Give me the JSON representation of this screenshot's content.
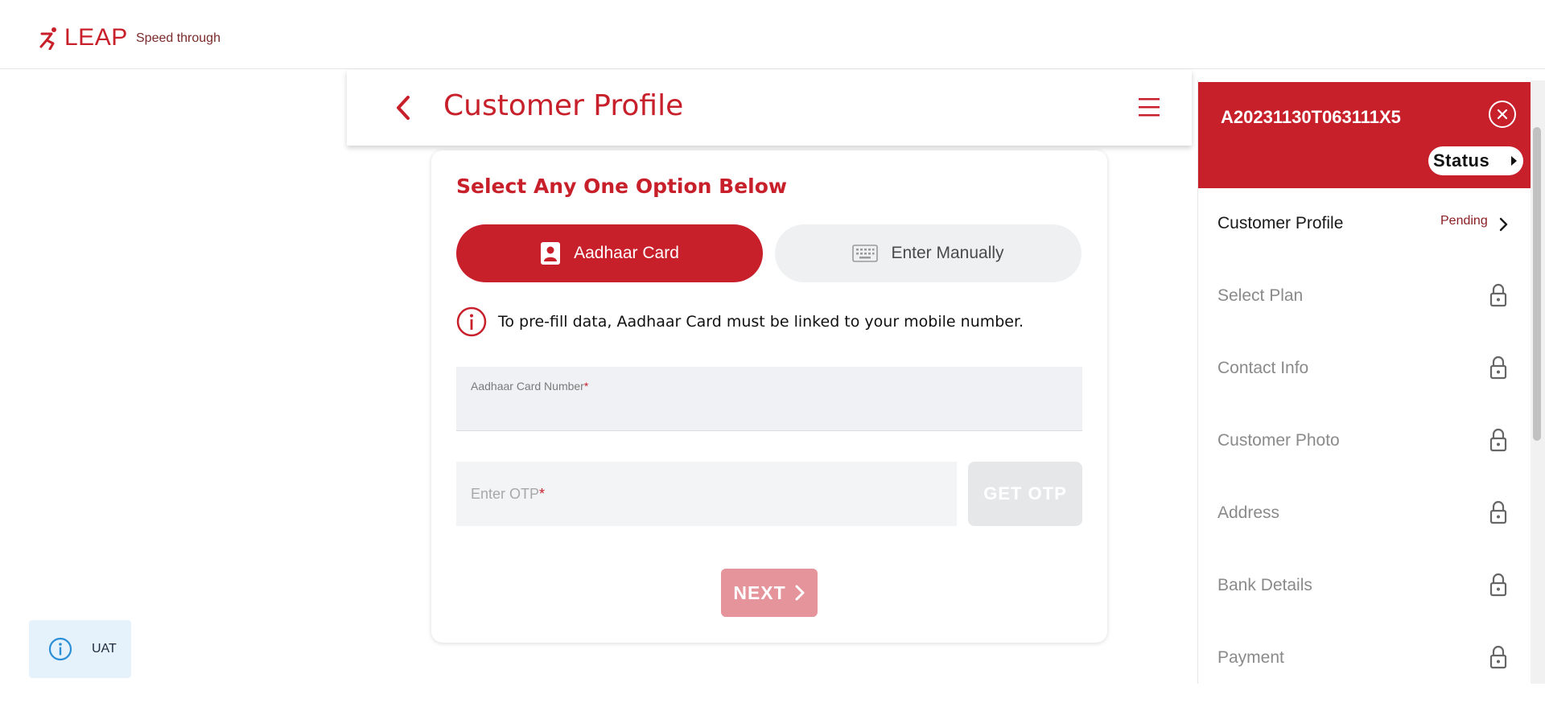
{
  "brand": {
    "logo_text": "LEAP",
    "tagline": "Speed through"
  },
  "header": {
    "title": "Customer Profile"
  },
  "form": {
    "section_title": "Select Any One Option Below",
    "option_aadhaar": "Aadhaar Card",
    "option_manual": "Enter Manually",
    "info_text": "To pre-fill data, Aadhaar Card must be linked to your mobile number.",
    "aadhaar_label": "Aadhaar Card Number",
    "required_mark": "*",
    "otp_placeholder": "Enter OTP",
    "get_otp_label": "GET OTP",
    "next_label": "NEXT"
  },
  "env_badge": {
    "label": "UAT"
  },
  "sidebar": {
    "application_id": "A20231130T063111X5",
    "status_label": "Status",
    "steps": [
      {
        "label": "Customer Profile",
        "status": "Pending",
        "locked": false
      },
      {
        "label": "Select Plan",
        "locked": true
      },
      {
        "label": "Contact Info",
        "locked": true
      },
      {
        "label": "Customer Photo",
        "locked": true
      },
      {
        "label": "Address",
        "locked": true
      },
      {
        "label": "Bank Details",
        "locked": true
      },
      {
        "label": "Payment",
        "locked": true
      }
    ]
  },
  "colors": {
    "brand_red": "#c8202b",
    "next_disabled": "#e4949a",
    "info_blue": "#2b8fd8"
  }
}
